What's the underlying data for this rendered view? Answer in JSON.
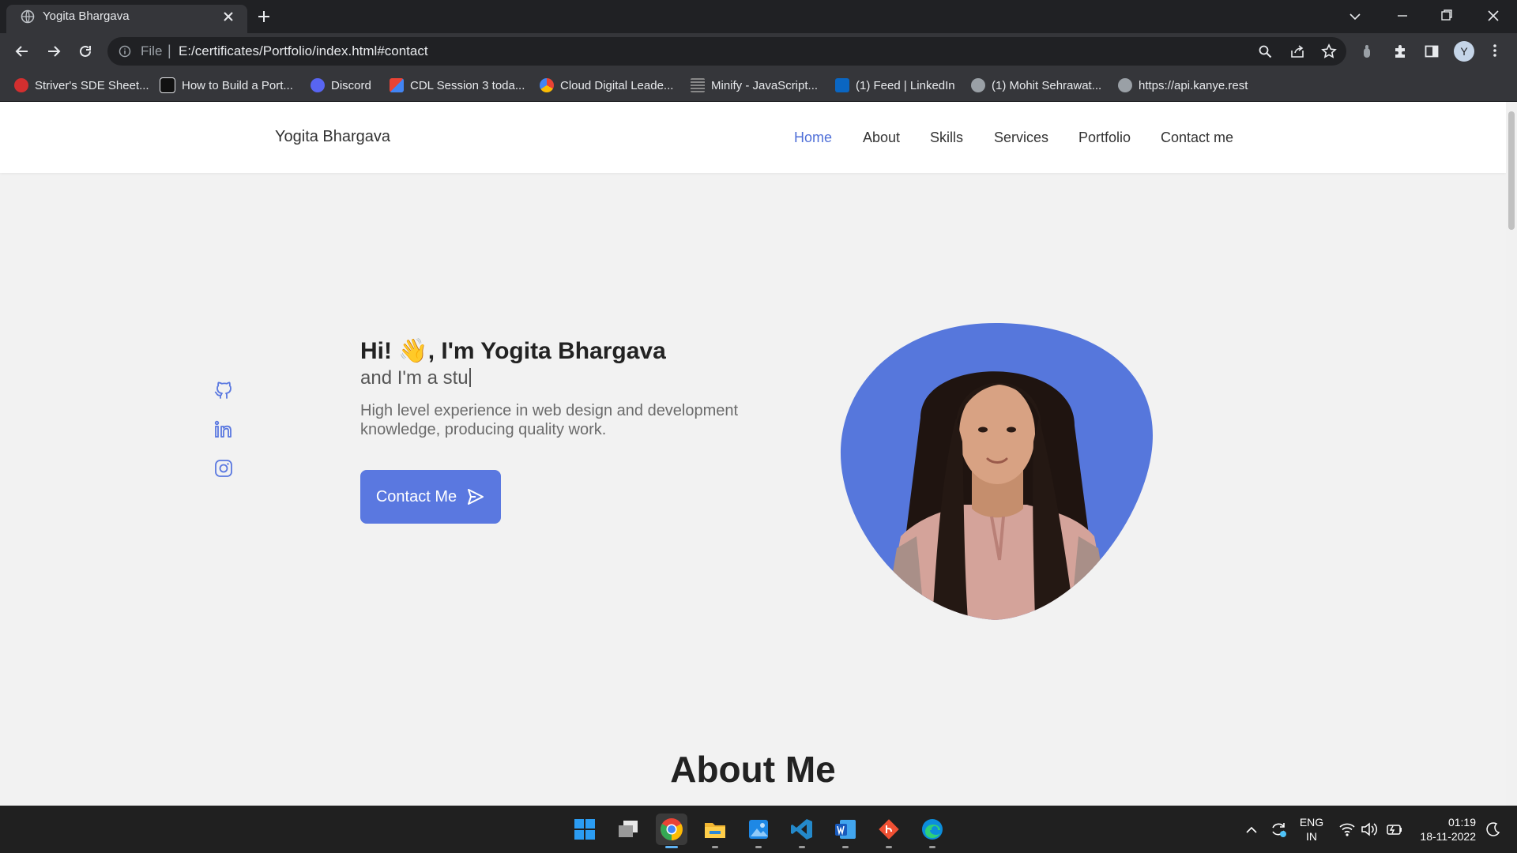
{
  "browser": {
    "tab_title": "Yogita Bhargava",
    "address": {
      "file_label": "File",
      "separator": "|",
      "url": "E:/certificates/Portfolio/index.html#contact"
    },
    "profile_initial": "Y",
    "bookmarks": [
      {
        "label": "Striver's SDE Sheet...",
        "icon": "tuf-icon",
        "color": "#d32f2f"
      },
      {
        "label": "How to Build a Port...",
        "icon": "a11y-icon",
        "color": "#111111"
      },
      {
        "label": "Discord",
        "icon": "discord-icon",
        "color": "#5865f2"
      },
      {
        "label": "CDL Session 3 toda...",
        "icon": "gmail-icon",
        "color": "#ea4335"
      },
      {
        "label": "Cloud Digital Leade...",
        "icon": "google-cloud-icon",
        "color": "#fbbc04"
      },
      {
        "label": "Minify - JavaScript...",
        "icon": "minify-icon",
        "color": "#888888"
      },
      {
        "label": "(1) Feed | LinkedIn",
        "icon": "linkedin-icon",
        "color": "#0a66c2"
      },
      {
        "label": "(1) Mohit Sehrawat...",
        "icon": "globe-icon",
        "color": "#9aa0a6"
      },
      {
        "label": "https://api.kanye.rest",
        "icon": "globe-icon",
        "color": "#9aa0a6"
      }
    ]
  },
  "site": {
    "brand": "Yogita Bhargava",
    "nav": [
      {
        "label": "Home",
        "active": true
      },
      {
        "label": "About",
        "active": false
      },
      {
        "label": "Skills",
        "active": false
      },
      {
        "label": "Services",
        "active": false
      },
      {
        "label": "Portfolio",
        "active": false
      },
      {
        "label": "Contact me",
        "active": false
      }
    ],
    "social_icons": [
      "github-icon",
      "linkedin-icon",
      "instagram-icon"
    ],
    "hero": {
      "title_pre": "Hi! ",
      "wave_emoji": "👋",
      "title_post": ", I'm Yogita Bhargava",
      "subtitle": "and I'm a stu",
      "description": "High level experience in web design and development knowledge, producing quality work.",
      "cta_label": "Contact Me"
    },
    "about_heading": "About Me",
    "accent_color": "#5a78e0"
  },
  "taskbar": {
    "apps": [
      "windows-start-icon",
      "task-view-icon",
      "chrome-icon",
      "file-explorer-icon",
      "photos-icon",
      "vscode-icon",
      "word-icon",
      "git-icon",
      "edge-icon"
    ],
    "active_app": "chrome-icon",
    "lang_line1": "ENG",
    "lang_line2": "IN",
    "time": "01:19",
    "date": "18-11-2022"
  }
}
